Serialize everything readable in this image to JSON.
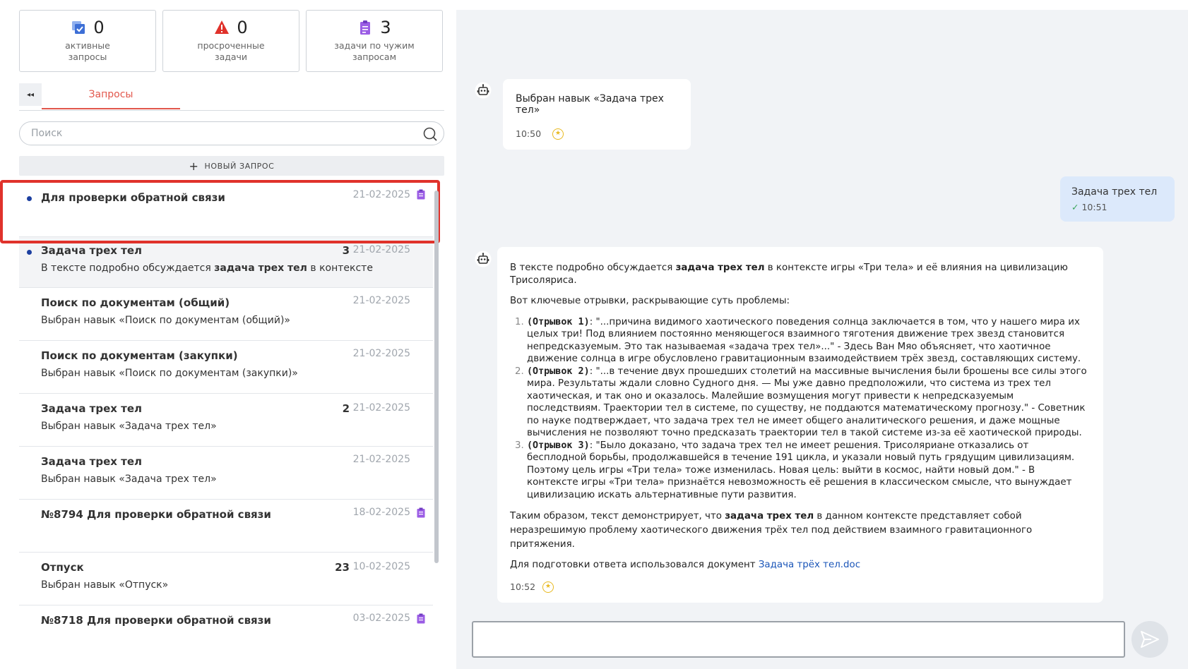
{
  "stats": [
    {
      "value": "0",
      "label_line1": "активные",
      "label_line2": "запросы",
      "icon": "copy-check-icon",
      "color": "#3d6fd6"
    },
    {
      "value": "0",
      "label_line1": "просроченные",
      "label_line2": "задачи",
      "icon": "warning-triangle-icon",
      "color": "#e0322b"
    },
    {
      "value": "3",
      "label_line1": "задачи по чужим",
      "label_line2": "запросам",
      "icon": "clipboard-icon",
      "color": "#9b5de5"
    }
  ],
  "tabs": {
    "collapse_glyph": "◂◂",
    "requests_label": "Запросы"
  },
  "search": {
    "placeholder": "Поиск"
  },
  "new_request": {
    "plus": "+",
    "label": "НОВЫЙ ЗАПРОС"
  },
  "requests": [
    {
      "title": "Для проверки обратной связи",
      "date": "21-02-2025",
      "count": "",
      "subtitle": "",
      "unread": true,
      "clipboard": true
    },
    {
      "title": "Задача трех тел",
      "date": "21-02-2025",
      "count": "3",
      "subtitle_pre": "В тексте подробно обсуждается ",
      "subtitle_bold": "задача трех тел",
      "subtitle_post": " в контексте игры «Три тела» и её влияния на цивилизацию Трисоляриса.",
      "unread": true,
      "clipboard": false
    },
    {
      "title": "Поиск по документам (общий)",
      "date": "21-02-2025",
      "count": "",
      "subtitle": "Выбран навык «Поиск по документам (общий)»",
      "unread": false,
      "clipboard": false
    },
    {
      "title": "Поиск по документам (закупки)",
      "date": "21-02-2025",
      "count": "",
      "subtitle": "Выбран навык «Поиск по документам (закупки)»",
      "unread": false,
      "clipboard": false
    },
    {
      "title": "Задача трех тел",
      "date": "21-02-2025",
      "count": "2",
      "subtitle": "Выбран навык «Задача трех тел»",
      "unread": false,
      "clipboard": false
    },
    {
      "title": "Задача трех тел",
      "date": "21-02-2025",
      "count": "",
      "subtitle": "Выбран навык «Задача трех тел»",
      "unread": false,
      "clipboard": false
    },
    {
      "title": "№8794 Для проверки обратной связи",
      "date": "18-02-2025",
      "count": "",
      "subtitle": "",
      "unread": false,
      "clipboard": true
    },
    {
      "title": "Отпуск",
      "date": "10-02-2025",
      "count": "23",
      "subtitle": "Выбран навык «Отпуск»",
      "unread": false,
      "clipboard": false
    },
    {
      "title": "№8718 Для проверки обратной связи",
      "date": "03-02-2025",
      "count": "",
      "subtitle": "",
      "unread": false,
      "clipboard": true
    }
  ],
  "chat": {
    "bot_msg1": {
      "text": "Выбран навык «Задача трех тел»",
      "time": "10:50"
    },
    "user_msg": {
      "text": "Задача трех тел",
      "time": "10:51",
      "check": "✓"
    },
    "bot_msg2": {
      "intro_pre": "В тексте подробно обсуждается ",
      "intro_bold": "задача трех тел",
      "intro_post": " в контексте игры «Три тела» и её влияния на цивилизацию Трисоляриса.",
      "lead": "Вот ключевые отрывки, раскрывающие суть проблемы:",
      "excerpts": [
        {
          "tag": "(Отрывок 1)",
          "text": ": \"...причина видимого хаотического поведения солнца заключается в том, что у нашего мира их целых три! Под влиянием постоянно меняющегося взаимного тяготения движение трех звезд становится непредсказуемым. Это так называемая «задача трех тел»...\" - Здесь Ван Мяо объясняет, что хаотичное движение солнца в игре обусловлено гравитационным взаимодействием трёх звезд, составляющих систему."
        },
        {
          "tag": "(Отрывок 2)",
          "text": ": \"...в течение двух прошедших столетий на массивные вычисления были брошены все силы этого мира. Результаты ждали словно Судного дня. — Мы уже давно предположили, что система из трех тел хаотическая, и так оно и оказалось. Малейшие возмущения могут привести к непредсказуемым последствиям. Траектории тел в системе, по существу, не поддаются математическому прогнозу.\" - Советник по науке подтверждает, что задача трех тел не имеет общего аналитического решения, и даже мощные вычисления не позволяют точно предсказать траектории тел в такой системе из-за её хаотической природы."
        },
        {
          "tag": "(Отрывок 3)",
          "text": ": \"Было доказано, что задача трех тел не имеет решения. Трисоляриане отказались от бесплодной борьбы, продолжавшейся в течение 191 цикла, и указали новый путь грядущим цивилизациям. Поэтому цель игры «Три тела» тоже изменилась. Новая цель: выйти в космос, найти новый дом.\" - В контексте игры «Три тела» признаётся невозможность её решения в классическом смысле, что вынуждает цивилизацию искать альтернативные пути развития."
        }
      ],
      "conclusion_pre": "Таким образом, текст демонстрирует, что ",
      "conclusion_bold": "задача трех тел",
      "conclusion_post": " в данном контексте представляет собой неразрешимую проблему хаотического движения трёх тел под действием взаимного гравитационного притяжения.",
      "source_pre": "Для подготовки ответа использовался документ ",
      "source_link": "Задача трёх тел.doc",
      "time": "10:52"
    },
    "star_glyph": "★",
    "composer_value": ""
  },
  "colors": {
    "accent": "#e2574c",
    "unread_dot": "#1c3fa0",
    "link": "#1a55b8",
    "highlight_frame": "#e0322b"
  }
}
